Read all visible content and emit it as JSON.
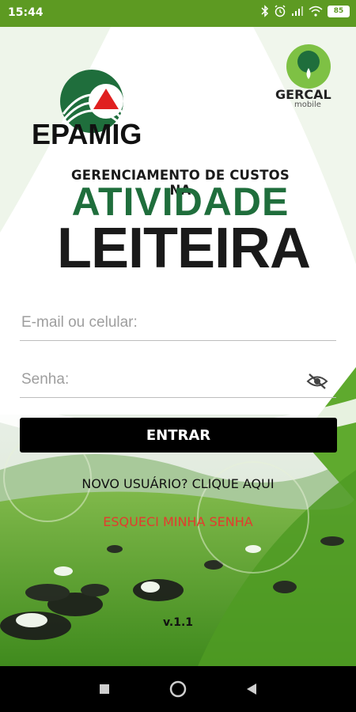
{
  "status_bar": {
    "time": "15:44",
    "battery": "85",
    "icons": [
      "bluetooth-icon",
      "alarm-icon",
      "signal-icon",
      "wifi-icon",
      "battery-icon"
    ]
  },
  "brand": {
    "epamig": "EPAMIG",
    "gercal_name": "GERCAL",
    "gercal_sub": "mobile"
  },
  "title": {
    "line1": "GERENCIAMENTO DE CUSTOS NA",
    "line2": "ATIVIDADE",
    "line3": "LEITEIRA"
  },
  "form": {
    "email_placeholder": "E-mail ou celular:",
    "email_value": "",
    "password_placeholder": "Senha:",
    "password_value": "",
    "enter_label": "ENTRAR"
  },
  "links": {
    "new_user": "NOVO USUÁRIO? CLIQUE AQUI",
    "forgot": "ESQUECI MINHA SENHA"
  },
  "version": "v.1.1",
  "colors": {
    "status_bar": "#5d9a22",
    "title_green": "#1f6e3c",
    "forgot_red": "#e33b2e",
    "button": "#000000"
  }
}
